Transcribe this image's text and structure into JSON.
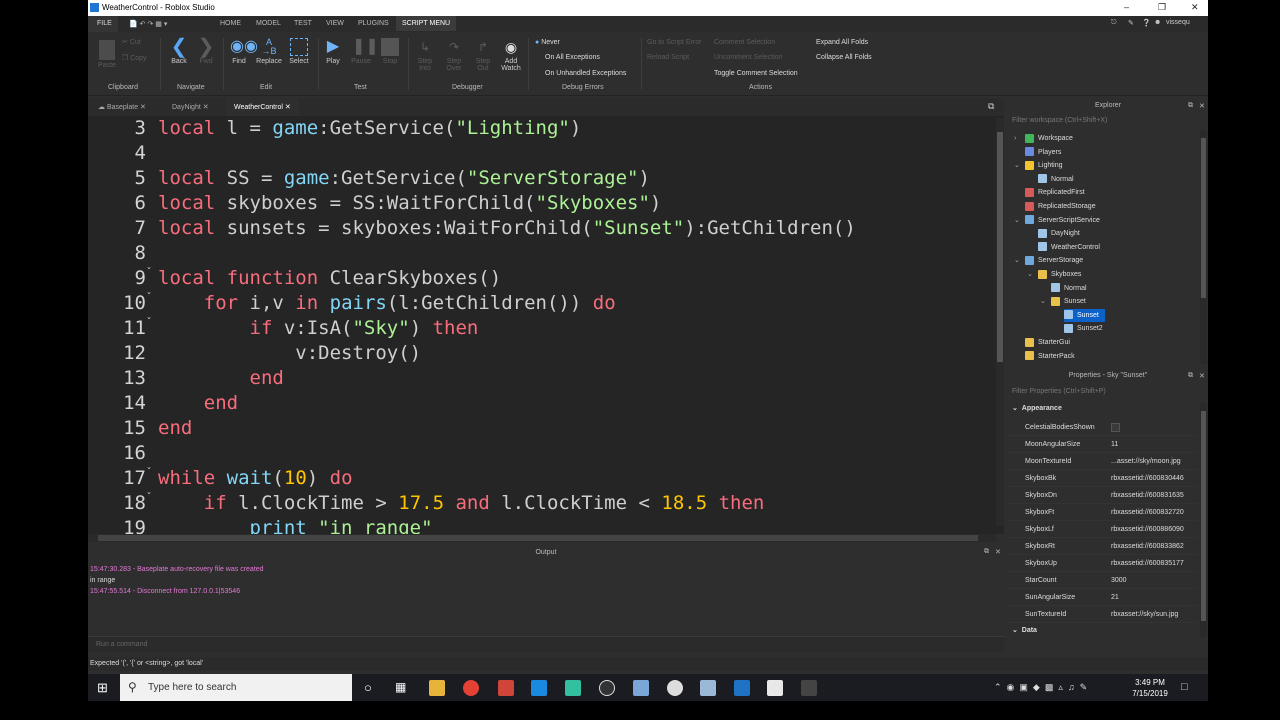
{
  "window": {
    "title": "WeatherControl - Roblox Studio"
  },
  "menu": {
    "file": "FILE",
    "tabs": [
      "HOME",
      "MODEL",
      "TEST",
      "VIEW",
      "PLUGINS",
      "SCRIPT MENU"
    ],
    "user": "vissequ"
  },
  "ribbon": {
    "clipboard": {
      "paste": "Paste",
      "cut": "Cut",
      "copy": "Copy",
      "group": "Clipboard"
    },
    "navigate": {
      "back": "Back",
      "fwd": "Fwd",
      "group": "Navigate"
    },
    "edit": {
      "find": "Find",
      "replace": "Replace",
      "select": "Select",
      "group": "Edit"
    },
    "test": {
      "play": "Play",
      "pause": "Pause",
      "stop": "Stop",
      "group": "Test"
    },
    "debugger": {
      "step_into": "Step Into",
      "step_over": "Step Over",
      "step_out": "Step Out",
      "add_watch": "Add Watch",
      "group": "Debugger"
    },
    "debug_errors": {
      "never": "Never",
      "all": "On All Exceptions",
      "unhandled": "On Unhandled Exceptions",
      "group": "Debug Errors"
    },
    "actions": {
      "goto": "Go to Script Error",
      "reload": "Reload Script",
      "comment": "Comment Selection",
      "uncomment": "Uncomment Selection",
      "toggle": "Toggle Comment Selection",
      "expand": "Expand All Folds",
      "collapse": "Collapse All Folds",
      "group": "Actions"
    }
  },
  "doc_tabs": [
    "Baseplate",
    "DayNight",
    "WeatherControl"
  ],
  "editor": {
    "lines": [
      {
        "n": "3",
        "tokens": [
          [
            "kw",
            "local"
          ],
          [
            "op",
            " l = "
          ],
          [
            "bi",
            "game"
          ],
          [
            "op",
            ":GetService("
          ],
          [
            "str",
            "\"Lighting\""
          ],
          [
            "op",
            ")"
          ]
        ]
      },
      {
        "n": "4",
        "tokens": []
      },
      {
        "n": "5",
        "tokens": [
          [
            "kw",
            "local"
          ],
          [
            "op",
            " SS = "
          ],
          [
            "bi",
            "game"
          ],
          [
            "op",
            ":GetService("
          ],
          [
            "str",
            "\"ServerStorage\""
          ],
          [
            "op",
            ")"
          ]
        ]
      },
      {
        "n": "6",
        "tokens": [
          [
            "kw",
            "local"
          ],
          [
            "op",
            " skyboxes = SS:WaitForChild("
          ],
          [
            "str",
            "\"Skyboxes\""
          ],
          [
            "op",
            ")"
          ]
        ]
      },
      {
        "n": "7",
        "tokens": [
          [
            "kw",
            "local"
          ],
          [
            "op",
            " sunsets = skyboxes:WaitForChild("
          ],
          [
            "str",
            "\"Sunset\""
          ],
          [
            "op",
            "):GetChildren()"
          ]
        ]
      },
      {
        "n": "8",
        "tokens": []
      },
      {
        "n": "9",
        "fold": true,
        "tokens": [
          [
            "kw",
            "local function"
          ],
          [
            "op",
            " ClearSkyboxes()"
          ]
        ]
      },
      {
        "n": "10",
        "fold": true,
        "tokens": [
          [
            "op",
            "    "
          ],
          [
            "kw",
            "for"
          ],
          [
            "op",
            " i,v "
          ],
          [
            "kw",
            "in"
          ],
          [
            "op",
            " "
          ],
          [
            "bi",
            "pairs"
          ],
          [
            "op",
            "(l:GetChildren()) "
          ],
          [
            "kw",
            "do"
          ]
        ]
      },
      {
        "n": "11",
        "fold": true,
        "tokens": [
          [
            "op",
            "        "
          ],
          [
            "kw",
            "if"
          ],
          [
            "op",
            " v:IsA("
          ],
          [
            "str",
            "\"Sky\""
          ],
          [
            "op",
            ") "
          ],
          [
            "kw",
            "then"
          ]
        ]
      },
      {
        "n": "12",
        "tokens": [
          [
            "op",
            "            v:Destroy()"
          ]
        ]
      },
      {
        "n": "13",
        "tokens": [
          [
            "op",
            "        "
          ],
          [
            "kw",
            "end"
          ]
        ]
      },
      {
        "n": "14",
        "tokens": [
          [
            "op",
            "    "
          ],
          [
            "kw",
            "end"
          ]
        ]
      },
      {
        "n": "15",
        "tokens": [
          [
            "kw",
            "end"
          ]
        ]
      },
      {
        "n": "16",
        "tokens": []
      },
      {
        "n": "17",
        "fold": true,
        "tokens": [
          [
            "kw",
            "while"
          ],
          [
            "op",
            " "
          ],
          [
            "bi",
            "wait"
          ],
          [
            "op",
            "("
          ],
          [
            "num",
            "10"
          ],
          [
            "op",
            ") "
          ],
          [
            "kw",
            "do"
          ]
        ]
      },
      {
        "n": "18",
        "fold": true,
        "tokens": [
          [
            "op",
            "    "
          ],
          [
            "kw",
            "if"
          ],
          [
            "op",
            " l.ClockTime > "
          ],
          [
            "num",
            "17.5"
          ],
          [
            "op",
            " "
          ],
          [
            "kw",
            "and"
          ],
          [
            "op",
            " l.ClockTime < "
          ],
          [
            "num",
            "18.5"
          ],
          [
            "op",
            " "
          ],
          [
            "kw",
            "then"
          ]
        ]
      },
      {
        "n": "19",
        "tokens": [
          [
            "op",
            "        "
          ],
          [
            "bi",
            "print"
          ],
          [
            "op",
            " "
          ],
          [
            "str",
            "\"in range\""
          ]
        ]
      }
    ]
  },
  "output": {
    "title": "Output",
    "lines": [
      {
        "text": "15:47:30.283 - Baseplate auto-recovery file was created",
        "color": "#e37ad6"
      },
      {
        "text": "in range",
        "color": "#dddddd"
      },
      {
        "text": "15:47:55.514 - Disconnect from 127.0.0.1|53546",
        "color": "#e37ad6"
      }
    ],
    "command_placeholder": "Run a command"
  },
  "status": "Expected '(', '{' or <string>, got 'local'",
  "explorer": {
    "title": "Explorer",
    "filter": "Filter workspace (Ctrl+Shift+X)",
    "items": [
      {
        "label": "Workspace",
        "color": "#3fb55c"
      },
      {
        "label": "Players",
        "color": "#6a8be0"
      },
      {
        "label": "Lighting",
        "color": "#f4c430"
      },
      {
        "label": "Normal",
        "color": "#9fc6e8"
      },
      {
        "label": "ReplicatedFirst",
        "color": "#d65a5a"
      },
      {
        "label": "ReplicatedStorage",
        "color": "#d65a5a"
      },
      {
        "label": "ServerScriptService",
        "color": "#6fa8dc"
      },
      {
        "label": "DayNight",
        "color": "#9fc6e8"
      },
      {
        "label": "WeatherControl",
        "color": "#9fc6e8"
      },
      {
        "label": "ServerStorage",
        "color": "#6fa8dc"
      },
      {
        "label": "Skyboxes",
        "color": "#e8c04a"
      },
      {
        "label": "Normal",
        "color": "#9fc6e8"
      },
      {
        "label": "Sunset",
        "color": "#e8c04a"
      },
      {
        "label": "Sunset",
        "color": "#9fc6e8"
      },
      {
        "label": "Sunset2",
        "color": "#9fc6e8"
      },
      {
        "label": "StarterGui",
        "color": "#e8c04a"
      },
      {
        "label": "StarterPack",
        "color": "#e8c04a"
      }
    ]
  },
  "properties": {
    "title": "Properties - Sky \"Sunset\"",
    "filter": "Filter Properties (Ctrl+Shift+P)",
    "section": "Appearance",
    "section2": "Data",
    "rows": [
      {
        "name": "CelestialBodiesShown",
        "value": ""
      },
      {
        "name": "MoonAngularSize",
        "value": "11"
      },
      {
        "name": "MoonTextureId",
        "value": "...asset://sky/moon.jpg"
      },
      {
        "name": "SkyboxBk",
        "value": "rbxassetid://600830446"
      },
      {
        "name": "SkyboxDn",
        "value": "rbxassetid://600831635"
      },
      {
        "name": "SkyboxFt",
        "value": "rbxassetid://600832720"
      },
      {
        "name": "SkyboxLf",
        "value": "rbxassetid://600886090"
      },
      {
        "name": "SkyboxRt",
        "value": "rbxassetid://600833862"
      },
      {
        "name": "SkyboxUp",
        "value": "rbxassetid://600835177"
      },
      {
        "name": "StarCount",
        "value": "3000"
      },
      {
        "name": "SunAngularSize",
        "value": "21"
      },
      {
        "name": "SunTextureId",
        "value": "rbxasset://sky/sun.jpg"
      }
    ]
  },
  "taskbar": {
    "search_placeholder": "Type here to search",
    "time": "3:49 PM",
    "date": "7/15/2019"
  }
}
